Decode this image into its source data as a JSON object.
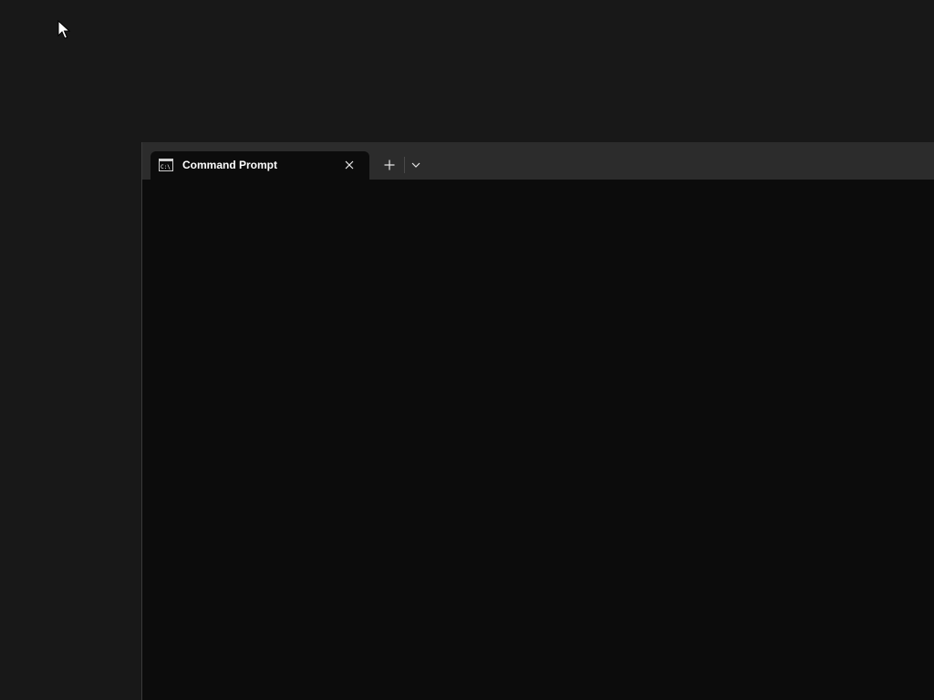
{
  "desktop": {
    "background": "#181818",
    "cursor_icon": "mouse-pointer-icon"
  },
  "terminal": {
    "tab": {
      "title": "Command Prompt",
      "icon": "command-prompt-icon",
      "close_icon": "close-icon"
    },
    "new_tab_icon": "plus-icon",
    "dropdown_icon": "chevron-down-icon",
    "colors": {
      "tab_bar": "#2c2c2c",
      "content": "#0c0c0c",
      "text": "#ffffff"
    }
  }
}
